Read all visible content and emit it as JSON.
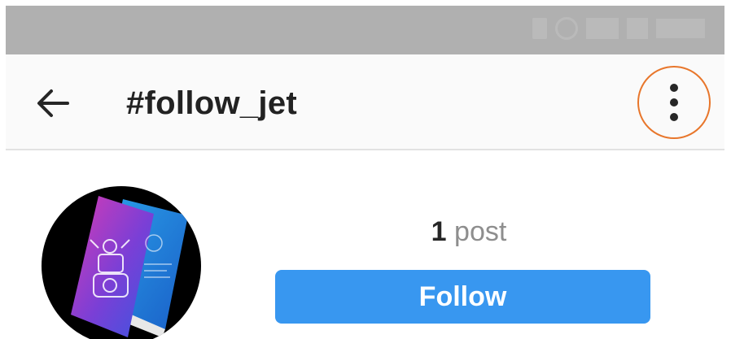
{
  "header": {
    "title": "#follow_jet",
    "back_icon": "arrow-left-icon",
    "more_icon": "more-vertical-icon"
  },
  "profile": {
    "post_count": "1",
    "post_label": "post",
    "follow_label": "Follow"
  },
  "colors": {
    "status_bar": "#b0b0b0",
    "header_bg": "#fafafa",
    "follow_button": "#3897f0",
    "highlight_ring": "#e8762b"
  }
}
